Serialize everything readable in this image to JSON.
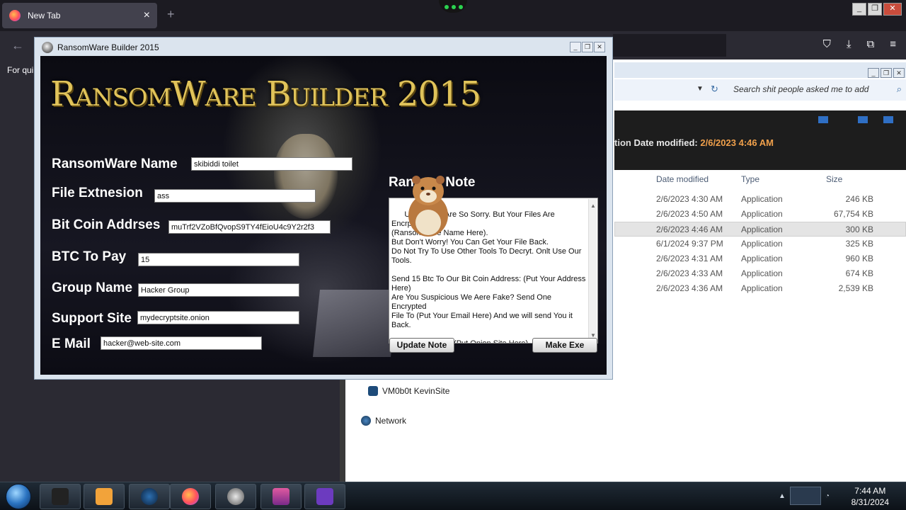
{
  "browser": {
    "tab_title": "New Tab",
    "tab_close": "×",
    "new_tab": "+",
    "back": "←",
    "bookmarks_text": "For qui",
    "nav_icons": [
      "pocket-icon",
      "download-icon",
      "extensions-icon",
      "menu-icon"
    ]
  },
  "top_controls": {
    "minimize": "_",
    "restore": "❐",
    "close": "✕"
  },
  "explorer": {
    "search_placeholder": "Search shit people asked me to add",
    "details_label": "Date modified:",
    "details_value": "2/6/2023 4:46 AM",
    "details_prefix": "tion",
    "columns": [
      "Date modified",
      "Type",
      "Size"
    ],
    "rows": [
      {
        "date": "2/6/2023 4:30 AM",
        "type": "Application",
        "size": "246 KB"
      },
      {
        "date": "2/6/2023 4:50 AM",
        "type": "Application",
        "size": "67,754 KB"
      },
      {
        "date": "2/6/2023 4:46 AM",
        "type": "Application",
        "size": "300 KB"
      },
      {
        "date": "6/1/2024 9:37 PM",
        "type": "Application",
        "size": "325 KB"
      },
      {
        "date": "2/6/2023 4:31 AM",
        "type": "Application",
        "size": "960 KB"
      },
      {
        "date": "2/6/2023 4:33 AM",
        "type": "Application",
        "size": "674 KB"
      },
      {
        "date": "2/6/2023 4:36 AM",
        "type": "Application",
        "size": "2,539 KB"
      }
    ],
    "tree": [
      "VM0b0t KevinSite",
      "Network"
    ]
  },
  "rw": {
    "window_title": "RansomWare Builder 2015",
    "header": "RansomWare Builder 2015",
    "labels": {
      "name": "RansomWare Name",
      "ext": "File Extnesion",
      "btc_addr": "Bit Coin Addrses",
      "btc_pay": "BTC To Pay",
      "group": "Group Name",
      "site": "Support Site",
      "email": "E Mail",
      "note": "Ransom Note"
    },
    "values": {
      "name": "skibiddi toilet",
      "ext": "ass",
      "btc_addr": "muTrf2VZoBfQvopS9TY4fEioU4c9Y2r2f3",
      "btc_pay": "15",
      "group": "Hacker Group",
      "site": "mydecryptsite.onion",
      "email": "hacker@web-site.com"
    },
    "note_text": "Uh Oh! We Are So Sorry. But Your Files Are Encrpyted By\n(RansomWare Name Here).\nBut Don't Worry! You Can Get Your File Back.\nDo Not Try To Use Other Tools To Decryt. Onlt Use Our\nTools.\n\nSend 15 Btc To Our Bit Coin Address: (Put Your Address\nHere)\nAre You Suspicious We Aere Fake? Send One Encrypted\nFile To (Put Your Email Here) And we will send You it\nBack.\n\nOur Support Site: (Put Onion Site Here)\nYou Files Were Encrypted By (Group Name)",
    "update_button": "Update Note",
    "make_button": "Make Exe"
  },
  "taskbar": {
    "time": "7:44 AM",
    "date": "8/31/2024"
  }
}
